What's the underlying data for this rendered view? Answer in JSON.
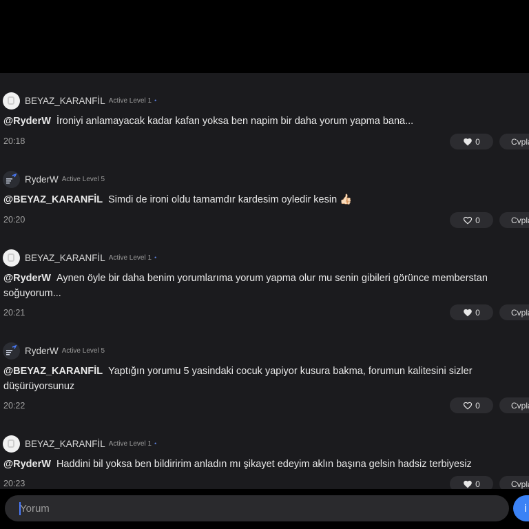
{
  "comments": [
    {
      "user": "BEYAZ_KARANFİL",
      "level": "Active Level 1",
      "dot": "•",
      "mention": "@RyderW",
      "body": "İroniyi anlamayacak kadar kafan yoksa ben napim bir daha yorum yapma bana...",
      "time": "20:18",
      "likes": "0",
      "liked": true,
      "reply": "Cvpla"
    },
    {
      "user": "RyderW",
      "level": "Active Level 5",
      "dot": "",
      "mention": "@BEYAZ_KARANFİL",
      "body": "Simdi de ironi oldu tamamdır kardesim oyledir kesin 👍🏻",
      "time": "20:20",
      "likes": "0",
      "liked": false,
      "reply": "Cvpla"
    },
    {
      "user": "BEYAZ_KARANFİL",
      "level": "Active Level 1",
      "dot": "•",
      "mention": "@RyderW",
      "body": "Aynen öyle bir daha benim yorumlarıma yorum yapma olur mu senin gibileri görünce memberstan soğuyorum...",
      "time": "20:21",
      "likes": "0",
      "liked": true,
      "reply": "Cvpla"
    },
    {
      "user": "RyderW",
      "level": "Active Level 5",
      "dot": "",
      "mention": "@BEYAZ_KARANFİL",
      "body": "Yaptığın yorumu 5 yasindaki cocuk yapiyor kusura bakma, forumun kalitesini sizler düşürüyorsunuz",
      "time": "20:22",
      "likes": "0",
      "liked": false,
      "reply": "Cvpla"
    },
    {
      "user": "BEYAZ_KARANFİL",
      "level": "Active Level 1",
      "dot": "•",
      "mention": "@RyderW",
      "body": "Haddini bil yoksa ben bildiririm anladın mı şikayet edeyim aklın başına gelsin hadsiz terbiyesiz",
      "time": "20:23",
      "likes": "0",
      "liked": true,
      "reply": "Cvpla"
    }
  ],
  "composer": {
    "placeholder": "Yorum",
    "send_label": "İ"
  },
  "icons": {
    "like_filled": "heart-filled-icon",
    "like_outline": "heart-outline-icon"
  }
}
